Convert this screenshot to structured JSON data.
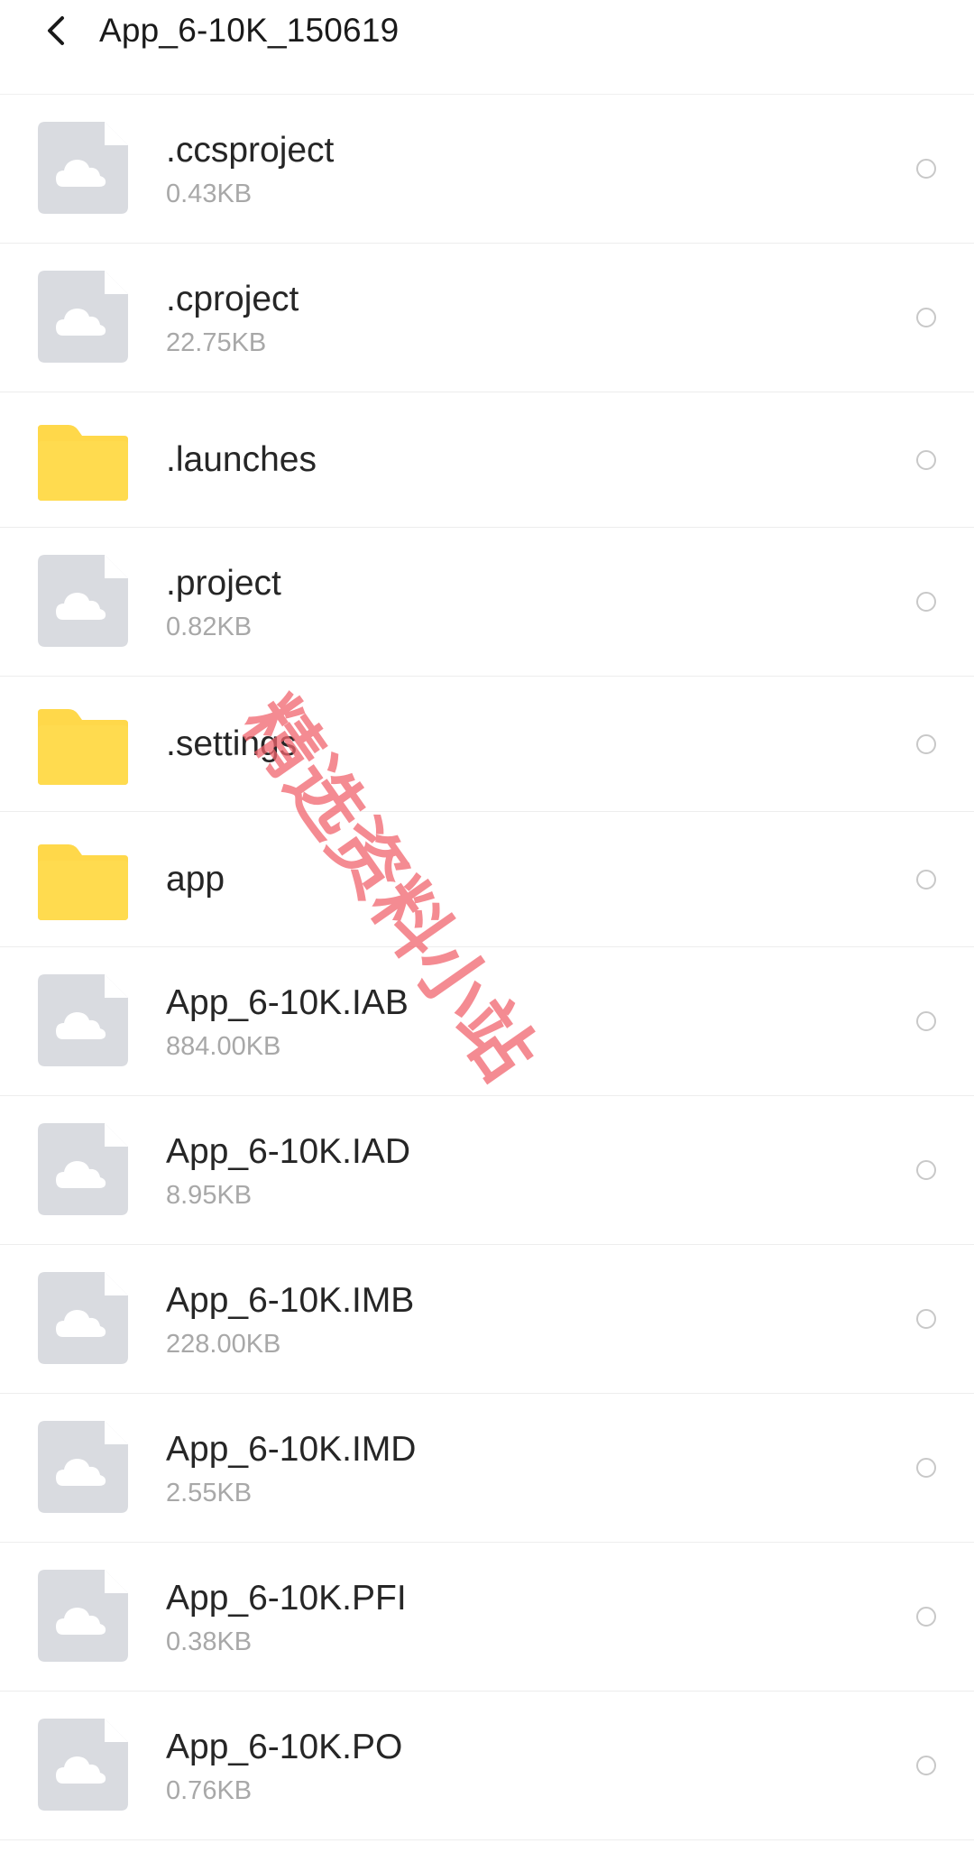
{
  "header": {
    "title": "App_6-10K_150619",
    "back_icon": "chevron-left-icon"
  },
  "files": [
    {
      "type": "file",
      "name": ".ccsproject",
      "size": "0.43KB"
    },
    {
      "type": "file",
      "name": ".cproject",
      "size": "22.75KB"
    },
    {
      "type": "folder",
      "name": ".launches",
      "size": ""
    },
    {
      "type": "file",
      "name": ".project",
      "size": "0.82KB"
    },
    {
      "type": "folder",
      "name": ".settings",
      "size": ""
    },
    {
      "type": "folder",
      "name": "app",
      "size": ""
    },
    {
      "type": "file",
      "name": "App_6-10K.IAB",
      "size": "884.00KB"
    },
    {
      "type": "file",
      "name": "App_6-10K.IAD",
      "size": "8.95KB"
    },
    {
      "type": "file",
      "name": "App_6-10K.IMB",
      "size": "228.00KB"
    },
    {
      "type": "file",
      "name": "App_6-10K.IMD",
      "size": "2.55KB"
    },
    {
      "type": "file",
      "name": "App_6-10K.PFI",
      "size": "0.38KB"
    },
    {
      "type": "file",
      "name": "App_6-10K.PO",
      "size": "0.76KB"
    }
  ],
  "watermark": {
    "text": "精选资料小站"
  },
  "colors": {
    "folder": "#FFD84A",
    "file_icon": "#D9DBE0",
    "cloud": "#FFFFFF",
    "watermark": "#F0646E"
  }
}
